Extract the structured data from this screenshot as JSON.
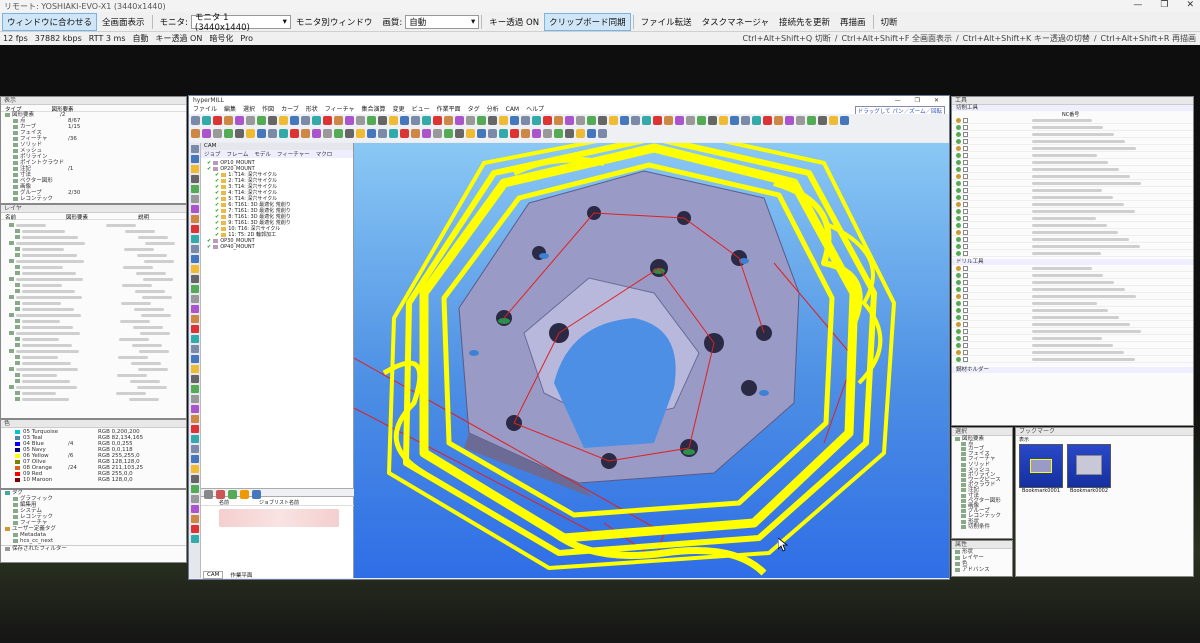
{
  "window": {
    "title": "リモート: YOSHIAKI-EVO-X1  (3440x1440)",
    "controls": [
      "—",
      "❐",
      "✕"
    ]
  },
  "toolbar": {
    "fit_window": "ウィンドウに合わせる",
    "fullscreen": "全画面表示",
    "monitor_label": "モニタ:",
    "monitor_value": "モニタ 1 (3440x1440)",
    "monitor_window": "モニタ別ウィンドウ",
    "quality_label": "画質:",
    "quality_value": "自動",
    "key_passthrough": "キー透過 ON",
    "clipboard_sync": "クリップボード同期",
    "file_transfer": "ファイル転送",
    "task_manager": "タスクマネージャ",
    "reconnect": "接続先を更新",
    "redraw": "再描画",
    "disconnect": "切断"
  },
  "status": {
    "fps": "12 fps",
    "bitrate": "37882 kbps",
    "rtt": "RTT 3 ms",
    "mode": "自動",
    "key": "キー透過 ON",
    "encryption": "暗号化",
    "edition": "Pro"
  },
  "shortcuts": [
    "Ctrl+Alt+Shift+Q 切断",
    "/",
    "Ctrl+Alt+Shift+F 全画面表示",
    "/",
    "Ctrl+Alt+Shift+K キー透過の切替",
    "/",
    "Ctrl+Alt+Shift+R 再描画"
  ],
  "hypermill": {
    "title": "hyperMILL",
    "menu": [
      "ファイル",
      "編集",
      "選択",
      "作図",
      "カーブ",
      "形状",
      "フィーチャ",
      "集合演算",
      "変更",
      "ビュー",
      "作業平面",
      "タグ",
      "分析",
      "CAM",
      "ヘルプ"
    ],
    "cmd_hint": "ドラッグして パン／ズーム／回転",
    "cam_label": "CAM",
    "cam_tabs": [
      "ジョブ",
      "フレーム",
      "モデル",
      "フィーチャー",
      "マクロ"
    ],
    "jobs": [
      "OP10_MOUNT",
      "OP20_MOUNT",
      "1: T14: 深穴サイクル",
      "2: T14: 深穴サイクル",
      "3: T14: 深穴サイクル",
      "4: T14: 深穴サイクル",
      "5: T14: 深穴サイクル",
      "6: T161: 3D 最適化 荒削り",
      "7: T161: 3D 最適化 荒削り",
      "8: T161: 3D 最適化 荒削り",
      "9: T161: 3D 最適化 荒削り",
      "10: T16: 深穴サイクル",
      "11: T5: 2D 輪郭加工",
      "OP30_MOUNT",
      "OP40_MOUNT"
    ],
    "bottom_list_headers": [
      "名前",
      "ジョブリスト名前"
    ],
    "bottom_tabs": [
      "CAM",
      "作業平面"
    ]
  },
  "left_panels": {
    "top_title": "表示",
    "columns": [
      "タイプ",
      "図形要素"
    ],
    "tree": [
      "図形要素",
      "点",
      "カーブ",
      "フェイス",
      "フィーチャ",
      "ソリッド",
      "メッシュ",
      "ポリライン",
      "ポイントクラウド",
      "注記",
      "寸法",
      "ベクター図形",
      "画像",
      "グループ",
      "レコンテック"
    ],
    "counts": [
      "/2",
      "8/67",
      "1/15",
      "",
      "/36",
      "",
      "",
      "",
      "",
      "/1",
      "",
      "",
      "",
      "2/30",
      ""
    ],
    "mid_title": "レイヤ",
    "mid_columns": [
      "名前",
      "図形要素",
      "説明"
    ],
    "colors_title": "色",
    "colors": [
      {
        "name": "05 Turquoise",
        "rgb": "RGB 0,200,200",
        "hex": "#00c8c8"
      },
      {
        "name": "03 Teal",
        "rgb": "RGB 82,134,165",
        "hex": "#5286a5"
      },
      {
        "name": "04 Blue",
        "rgb": "RGB 0,0,255",
        "hex": "#0000ff"
      },
      {
        "name": "05 Navy",
        "rgb": "RGB 0,0,118",
        "hex": "#000076"
      },
      {
        "name": "06 Yellow",
        "rgb": "RGB 255,255,0",
        "hex": "#ffff00"
      },
      {
        "name": "07 Olive",
        "rgb": "RGB 128,128,0",
        "hex": "#808000"
      },
      {
        "name": "08 Orange",
        "rgb": "RGB 211,103,25",
        "hex": "#d36719"
      },
      {
        "name": "09 Red",
        "rgb": "RGB 255,0,0",
        "hex": "#ff0000"
      },
      {
        "name": "10 Maroon",
        "rgb": "RGB 128,0,0",
        "hex": "#800000"
      }
    ],
    "color_counts": [
      "",
      "",
      "/4",
      "",
      "/6",
      "",
      "/24",
      "",
      ""
    ],
    "tags_title": "タグ",
    "tags": [
      "グラフィック",
      "編集用",
      "システム",
      "レコンテック",
      "フィーチャ"
    ],
    "user_tags_title": "ユーザー定義タグ",
    "user_tags": [
      "Metadata",
      "hcs_cc_next"
    ],
    "filter": "保存されたフィルター"
  },
  "right_panels": {
    "title": "工具",
    "cutting_tools": "切削工具",
    "tool_col": "NC番号",
    "drill_tools": "ドリル工具",
    "holder": "鋼材ホルダー",
    "select_title": "選択",
    "select_tree": [
      "図形要素",
      "点",
      "カーブ",
      "フェイス",
      "フィーチャ",
      "ソリッド",
      "メッシュ",
      "ポリライン",
      "ワークピース",
      "ポクラウド",
      "注記",
      "寸法",
      "ベクター図形",
      "画像",
      "グループ",
      "レコンテック",
      "形状",
      "切削条件"
    ],
    "bookmark_title": "ブックマーク",
    "bookmark_header": "表示",
    "bookmarks": [
      "Bookmark0001",
      "Bookmark0002"
    ],
    "props_title": "属性",
    "props": [
      "形状",
      "レイヤー",
      "色",
      "アドバンス"
    ]
  },
  "colors": {
    "accent": "#cfe6f8",
    "toolpath": "#ffff00",
    "viewport_top": "#8ac8f4",
    "viewport_bottom": "#2f6ee6",
    "part": "#8f8fbf"
  }
}
